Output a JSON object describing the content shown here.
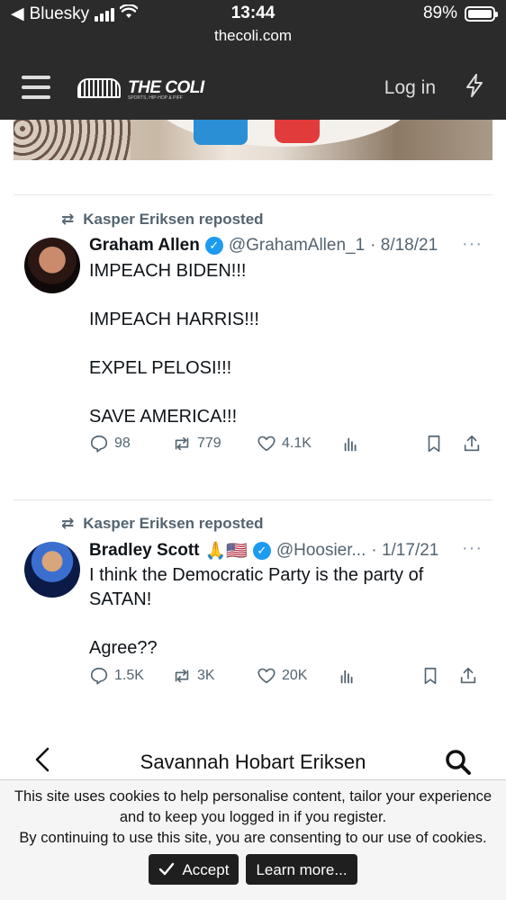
{
  "status_bar": {
    "back_app": "Bluesky",
    "time": "13:44",
    "battery": "89%",
    "url": "thecoli.com"
  },
  "header": {
    "logo_text": "THE COLI",
    "logo_tagline": "SPORTS, HIP-HOP & PIFF",
    "login_label": "Log in"
  },
  "tweets": [
    {
      "repost_label": "Kasper Eriksen reposted",
      "name": "Graham Allen",
      "handle": "@GrahamAllen_1",
      "date": "· 8/18/21",
      "lines": [
        "IMPEACH BIDEN!!!",
        "IMPEACH HARRIS!!!",
        "EXPEL PELOSI!!!",
        "SAVE AMERICA!!!"
      ],
      "replies": "98",
      "reposts": "779",
      "likes": "4.1K"
    },
    {
      "repost_label": "Kasper Eriksen reposted",
      "name": "Bradley Scott",
      "name_emoji": "🙏🇺🇸",
      "handle": "@Hoosier...",
      "date": "· 1/17/21",
      "lines": [
        "I think the Democratic Party is the party of",
        "SATAN!",
        "Agree??"
      ],
      "replies": "1.5K",
      "reposts": "3K",
      "likes": "20K"
    }
  ],
  "bottom_nav": {
    "title": "Savannah Hobart Eriksen"
  },
  "cookie_notice": {
    "line1": "This site uses cookies to help personalise content, tailor your experience",
    "line2": "and to keep you logged in if you register.",
    "line3": "By continuing to use this site, you are consenting to our use of cookies.",
    "accept_label": "Accept",
    "learn_more_label": "Learn more..."
  },
  "colors": {
    "header_bg": "#2b2b2b",
    "verified_blue": "#1d9bf0",
    "muted_text": "#536471"
  }
}
